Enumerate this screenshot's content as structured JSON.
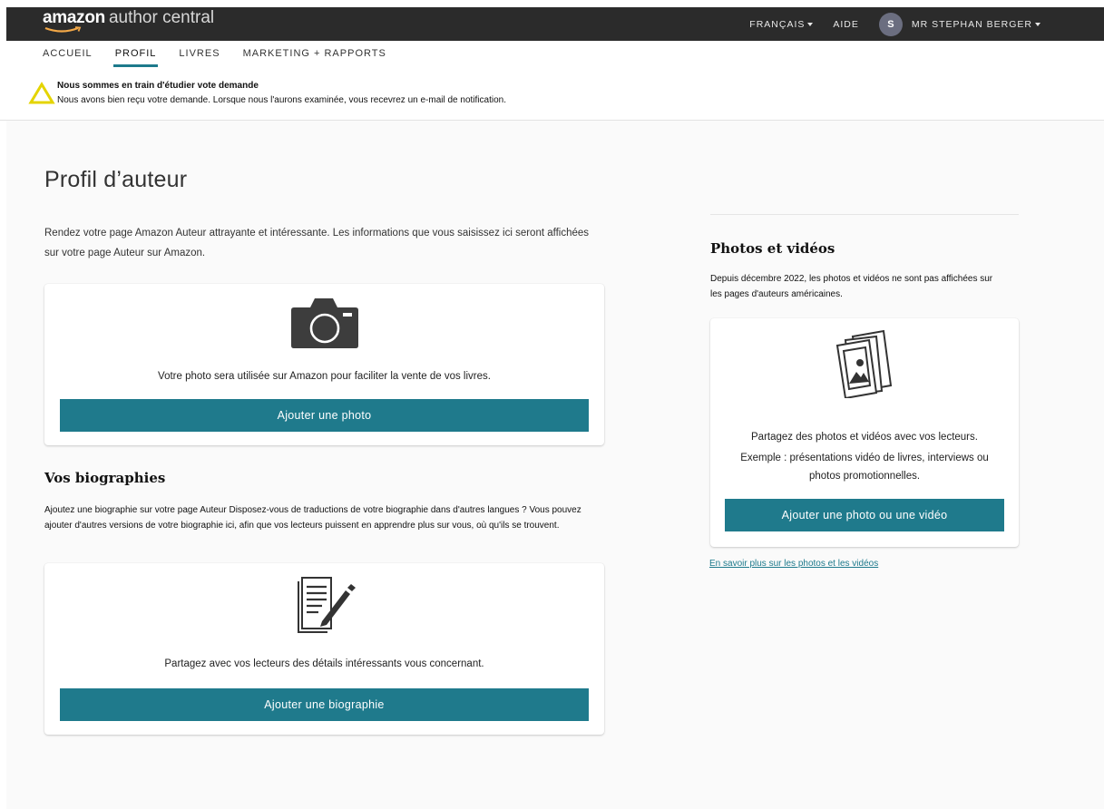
{
  "topbar": {
    "logo_brand": "amazon",
    "logo_product": "author central",
    "language_label": "FRANÇAIS",
    "help_label": "AIDE",
    "avatar_initial": "S",
    "user_name": "MR STEPHAN BERGER"
  },
  "tabs": [
    {
      "label": "ACCUEIL",
      "active": false
    },
    {
      "label": "PROFIL",
      "active": true
    },
    {
      "label": "LIVRES",
      "active": false
    },
    {
      "label": "MARKETING + RAPPORTS",
      "active": false
    }
  ],
  "notice": {
    "icon": "warning-triangle-icon",
    "title": "Nous sommes en train d'étudier vote demande",
    "text": "Nous avons bien reçu votre demande. Lorsque nous l'aurons examinée, vous recevrez un e-mail de notification."
  },
  "profile": {
    "title": "Profil d’auteur",
    "intro": "Rendez votre page Amazon Auteur attrayante et intéressante. Les informations que vous saisissez ici seront affichées sur votre page Auteur sur Amazon."
  },
  "photo_card": {
    "icon": "camera-icon",
    "text": "Votre photo sera utilisée sur Amazon pour faciliter la vente de vos livres.",
    "button_label": "Ajouter une photo"
  },
  "bio": {
    "title": "Vos biographies",
    "text": "Ajoutez une biographie sur votre page Auteur Disposez-vous de traductions de votre biographie dans d'autres langues ? Vous pouvez ajouter d'autres versions de votre biographie ici, afin que vos lecteurs puissent en apprendre plus sur vous, où qu'ils se trouvent.",
    "card_icon": "document-pen-icon",
    "card_text": "Partagez avec vos lecteurs des détails intéressants vous concernant.",
    "button_label": "Ajouter une biographie"
  },
  "media": {
    "title": "Photos et vidéos",
    "text": "Depuis décembre 2022, les photos et vidéos ne sont pas affichées sur les pages d'auteurs américaines.",
    "card_icon": "photo-stack-icon",
    "card_text_line1": "Partagez des photos et vidéos avec vos lecteurs.",
    "card_text_line2": "Exemple : présentations vidéo de livres, interviews ou",
    "card_text_line3": "photos promotionnelles.",
    "button_label": "Ajouter une photo ou une vidéo",
    "learn_more": "En savoir plus sur les photos et les vidéos"
  },
  "colors": {
    "topbar": "#2b2b2b",
    "accent": "#1f7a8c",
    "warning": "#e4d400"
  }
}
